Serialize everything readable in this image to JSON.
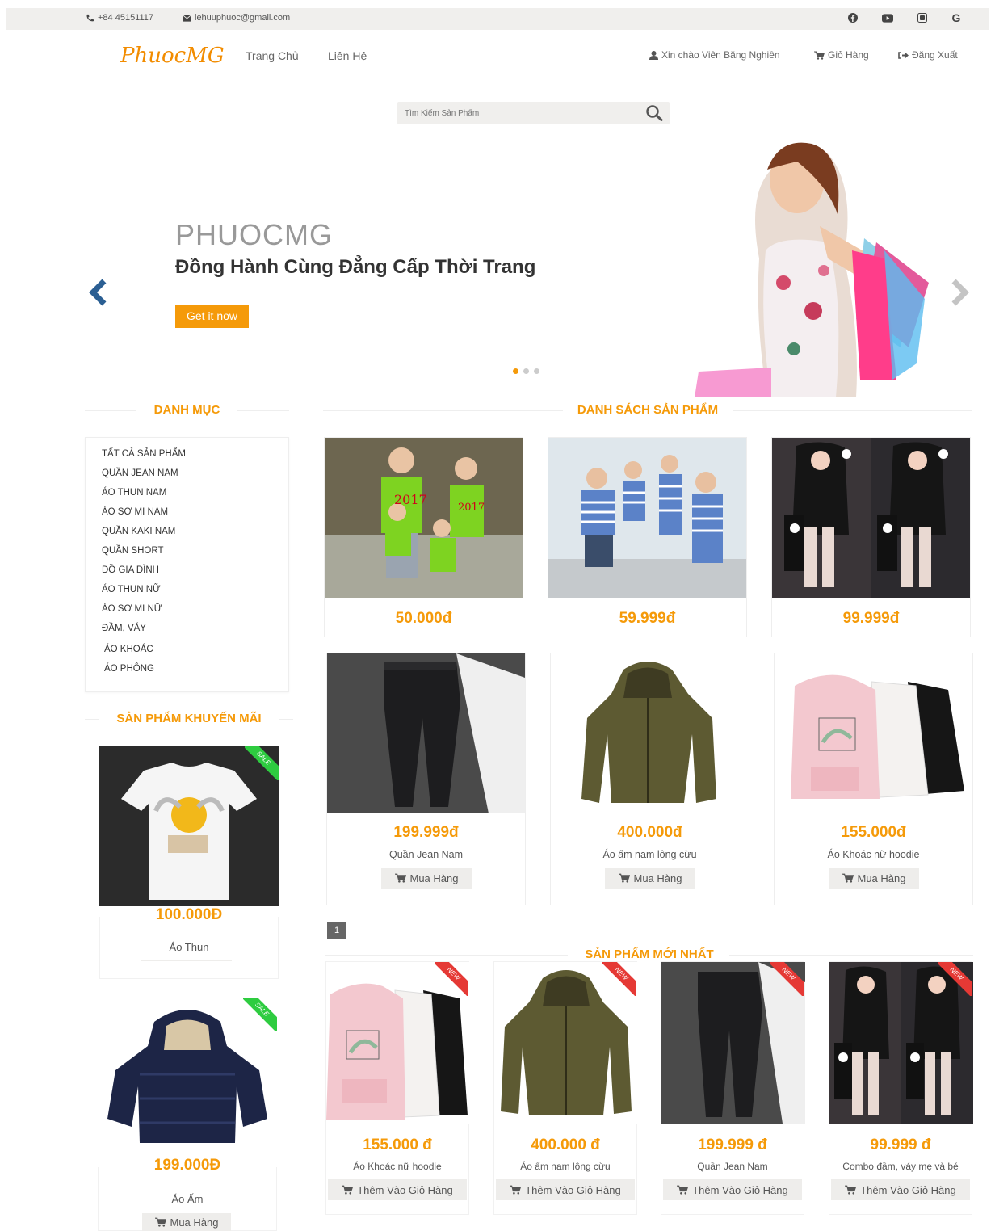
{
  "topbar": {
    "phone": "+84 45151117",
    "email": "lehuuphuoc@gmail.com"
  },
  "nav": {
    "logo": "PhuocMG",
    "home": "Trang Chủ",
    "contact": "Liên Hệ",
    "greeting": "Xin chào Viên Băng Nghiền",
    "cart": "Giỏ Hàng",
    "logout": "Đăng Xuất"
  },
  "search": {
    "placeholder": "Tìm Kiếm Sản Phẩm"
  },
  "hero": {
    "brand": "PHUOCMG",
    "tagline": "Đồng Hành Cùng Đẳng Cấp Thời Trang",
    "cta": "Get it now"
  },
  "sections": {
    "categories": "DANH MỤC",
    "products": "DANH SÁCH SẢN PHẨM",
    "promo": "SẢN PHẨM KHUYẾN MÃI",
    "newest": "SẢN PHẨM MỚI NHẤT"
  },
  "categories": [
    "TẤT CẢ SẢN PHẨM",
    "QUẦN JEAN NAM",
    "ÁO THUN NAM",
    "ÁO SƠ MI NAM",
    "QUẦN KAKI NAM",
    "QUẦN SHORT",
    "ĐỒ GIA ĐÌNH",
    "ÁO THUN NỮ",
    "ÁO SƠ MI NỮ",
    "ĐẦM, VÁY",
    "ÁO KHOÁC",
    "ÁO PHÔNG"
  ],
  "products": [
    {
      "price": "50.000đ"
    },
    {
      "price": "59.999đ"
    },
    {
      "price": "99.999đ"
    },
    {
      "price": "199.999đ",
      "name": "Quần Jean Nam",
      "buy": "Mua Hàng"
    },
    {
      "price": "400.000đ",
      "name": "Áo ấm nam lông cừu",
      "buy": "Mua Hàng"
    },
    {
      "price": "155.000đ",
      "name": "Áo Khoác nữ hoodie",
      "buy": "Mua Hàng"
    }
  ],
  "pagination": {
    "current": "1"
  },
  "promo": [
    {
      "price": "100.000Đ",
      "name": "Áo Thun",
      "badge": "SALE"
    },
    {
      "price": "199.000Đ",
      "name": "Áo Ấm",
      "badge": "SALE",
      "buy": "Mua Hàng"
    }
  ],
  "newest": [
    {
      "price": "155.000 đ",
      "name": "Áo Khoác nữ hoodie",
      "badge": "NEW",
      "buy": "Thêm Vào Giỏ Hàng"
    },
    {
      "price": "400.000 đ",
      "name": "Áo ấm nam lông cừu",
      "badge": "NEW",
      "buy": "Thêm Vào Giỏ Hàng"
    },
    {
      "price": "199.999 đ",
      "name": "Quần Jean Nam",
      "badge": "NEW",
      "buy": "Thêm Vào Giỏ Hàng"
    },
    {
      "price": "99.999 đ",
      "name": "Combo đầm, váy mẹ và bé",
      "badge": "NEW",
      "buy": "Thêm Vào Giỏ Hàng"
    }
  ],
  "colors": {
    "accent": "#f59a09",
    "topbar": "#f0efed",
    "arrow_left": "#2b5f93"
  },
  "icons": [
    "phone-icon",
    "envelope-icon",
    "facebook-icon",
    "youtube-icon",
    "instagram-icon",
    "google-icon",
    "user-icon",
    "cart-icon",
    "sign-out-icon",
    "search-icon",
    "chevron-left-icon",
    "chevron-right-icon"
  ]
}
